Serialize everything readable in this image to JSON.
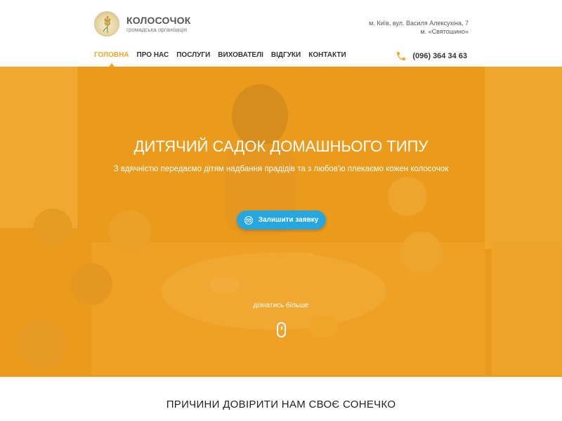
{
  "brand": {
    "name": "КОЛОСОЧОК",
    "subtitle": "громадська організація",
    "logo_icon": "wheat-logo-icon"
  },
  "address": {
    "line1": "м. Київ, вул. Василя Алексухіна, 7",
    "line2": "м. «Святошино»"
  },
  "nav": {
    "items": [
      {
        "label": "ГОЛОВНА",
        "active": true
      },
      {
        "label": "ПРО НАС",
        "active": false
      },
      {
        "label": "ПОСЛУГИ",
        "active": false
      },
      {
        "label": "ВИХОВАТЕЛІ",
        "active": false
      },
      {
        "label": "ВІДГУКИ",
        "active": false
      },
      {
        "label": "КОНТАКТИ",
        "active": false
      }
    ]
  },
  "phone": {
    "icon": "phone-icon",
    "number": "(096) 364 34 63"
  },
  "hero": {
    "title": "ДИТЯЧИЙ САДОК ДОМАШНЬОГО ТИПУ",
    "subtitle": "З вдячністю передаємо дітям надбання прадідів та з любов'ю плекаємо кожен колосочок",
    "cta_label": "Залишити заявку",
    "cta_icon": "mail-icon",
    "learn_more": "дізнатись більше",
    "scroll_icon": "mouse-scroll-icon"
  },
  "section": {
    "title": "ПРИЧИНИ ДОВІРИТИ НАМ СВОЄ СОНЕЧКО"
  },
  "colors": {
    "accent": "#f3a52c",
    "overlay": "#f0a01e",
    "cta": "#27a7e0"
  }
}
